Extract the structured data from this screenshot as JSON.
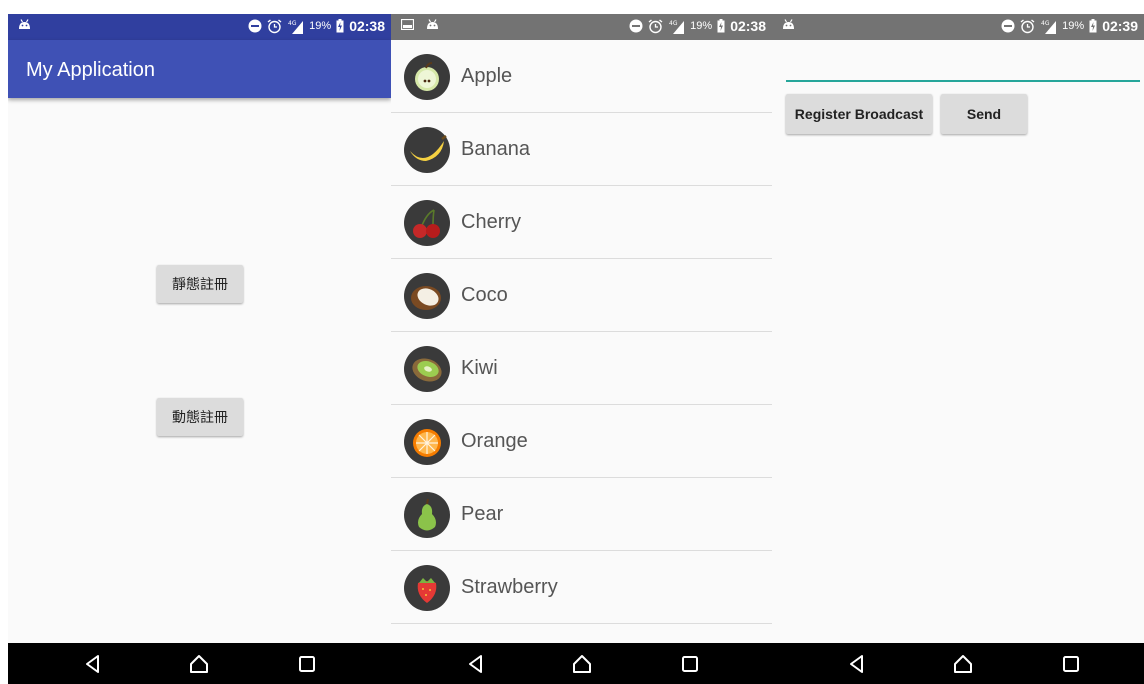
{
  "colors": {
    "primary": "#3f51b5",
    "primary_dark": "#303f9f",
    "statusbar_gray": "#737373",
    "accent": "#26a69a",
    "button": "#dcdcdc",
    "background": "#fafafa"
  },
  "screen1": {
    "status": {
      "battery": "19%",
      "time": "02:38"
    },
    "app_title": "My Application",
    "buttons": {
      "static_register": "靜態註冊",
      "dynamic_register": "動態註冊"
    }
  },
  "screen2": {
    "status": {
      "battery": "19%",
      "time": "02:38"
    },
    "fruits": [
      {
        "name": "Apple",
        "icon": "apple-icon"
      },
      {
        "name": "Banana",
        "icon": "banana-icon"
      },
      {
        "name": "Cherry",
        "icon": "cherry-icon"
      },
      {
        "name": "Coco",
        "icon": "coconut-icon"
      },
      {
        "name": "Kiwi",
        "icon": "kiwi-icon"
      },
      {
        "name": "Orange",
        "icon": "orange-icon"
      },
      {
        "name": "Pear",
        "icon": "pear-icon"
      },
      {
        "name": "Strawberry",
        "icon": "strawberry-icon"
      }
    ]
  },
  "screen3": {
    "status": {
      "battery": "19%",
      "time": "02:39"
    },
    "input": {
      "value": "",
      "placeholder": ""
    },
    "buttons": {
      "register_broadcast": "Register Broadcast",
      "send": "Send"
    }
  }
}
